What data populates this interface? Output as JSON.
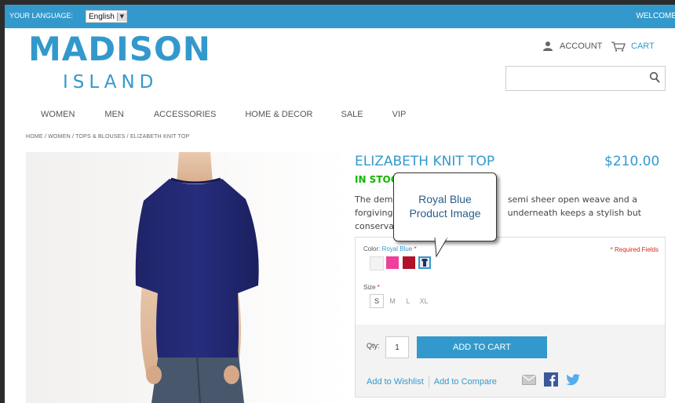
{
  "topbar": {
    "language_label": "YOUR LANGUAGE:",
    "language_value": "English",
    "welcome": "WELCOME"
  },
  "logo": {
    "line1": "MADISON",
    "line2": "ISLAND"
  },
  "header": {
    "account": "ACCOUNT",
    "cart": "CART",
    "search_value": ""
  },
  "nav": {
    "items": [
      "WOMEN",
      "MEN",
      "ACCESSORIES",
      "HOME & DECOR",
      "SALE",
      "VIP"
    ]
  },
  "breadcrumb": "HOME / WOMEN / TOPS & BLOUSES / ELIZABETH KNIT TOP",
  "product": {
    "name": "ELIZABETH KNIT TOP",
    "price": "$210.00",
    "stock": "IN STOCK",
    "desc_line1": "The demu",
    "desc_line1b": "semi sheer open weave and a",
    "desc_line2": "forgiving s",
    "desc_line2b": "underneath keeps a stylish but",
    "desc_line3": "conservati"
  },
  "options": {
    "color_label": "Color:",
    "color_value": "Royal Blue",
    "required_note": "* Required Fields",
    "swatches": [
      "#f3f3f3",
      "#ee3f9c",
      "#b0122a",
      "#1c2f6e"
    ],
    "size_label": "Size",
    "sizes": [
      "S",
      "M",
      "L",
      "XL"
    ]
  },
  "actions": {
    "qty_label": "Qty:",
    "qty_value": "1",
    "add_to_cart": "ADD TO CART",
    "wishlist": "Add to Wishlist",
    "compare": "Add to Compare"
  },
  "callout": {
    "line1": "Royal Blue",
    "line2": "Product Image"
  },
  "icons": {
    "account": "person-icon",
    "cart": "cart-icon",
    "search": "search-icon",
    "email": "email-icon",
    "facebook": "facebook-icon",
    "twitter": "twitter-icon"
  },
  "colors": {
    "brand": "#3399cc",
    "stock": "#11b400",
    "required": "#d9291c"
  }
}
